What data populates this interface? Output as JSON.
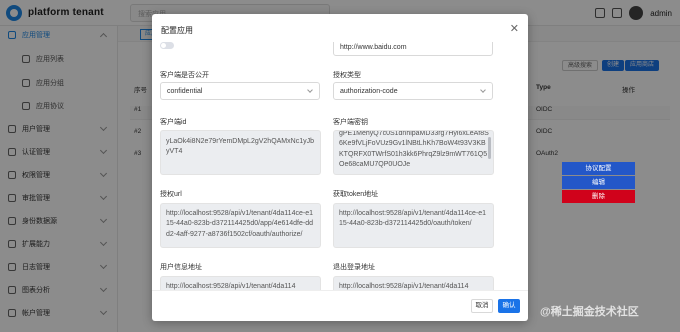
{
  "header": {
    "brand": "platform tenant",
    "search_placeholder": "搜索应用",
    "user": "admin"
  },
  "sidebar": {
    "items": [
      {
        "label": "应用管理",
        "icon": "grid-icon"
      },
      {
        "label": "应用列表",
        "icon": "list-icon"
      },
      {
        "label": "应用分组",
        "icon": "list-icon"
      },
      {
        "label": "应用协议",
        "icon": "doc-icon"
      },
      {
        "label": "用户管理",
        "icon": "user-icon"
      },
      {
        "label": "认证管理",
        "icon": "shield-icon"
      },
      {
        "label": "权限管理",
        "icon": "key-icon"
      },
      {
        "label": "审批管理",
        "icon": "check-icon"
      },
      {
        "label": "身份数据源",
        "icon": "database-icon"
      },
      {
        "label": "扩展能力",
        "icon": "puzzle-icon"
      },
      {
        "label": "日志管理",
        "icon": "log-icon"
      },
      {
        "label": "图表分析",
        "icon": "chart-icon"
      },
      {
        "label": "帐户管理",
        "icon": "account-icon"
      }
    ]
  },
  "content": {
    "tab_label": "应用",
    "buttons": {
      "search": "高级搜索",
      "create": "创建",
      "store": "应用商店"
    },
    "table": {
      "headers": {
        "index": "序号",
        "type": "Type",
        "actions": "操作"
      },
      "rows": [
        {
          "index": "#1",
          "type": "OIDC"
        },
        {
          "index": "#2",
          "type": "OIDC"
        },
        {
          "index": "#3",
          "type": "OAuth2"
        }
      ]
    },
    "row_menu": [
      "协议配置",
      "编辑",
      "删除"
    ]
  },
  "modal": {
    "title": "配置应用",
    "fields": {
      "homepage_value": "http://www.baidu.com",
      "is_public_label": "客户端是否公开",
      "is_public_value": "confidential",
      "grant_type_label": "授权类型",
      "grant_type_value": "authorization-code",
      "client_id_label": "客户端id",
      "client_id_value": "yLaOk4i8N2e79rYemDMpL2gV2hQAMxNc1yJbyVT4",
      "client_secret_label": "客户端密钥",
      "client_secret_value": "gPE1MehyQ7c0S1dnhipaMD33rg7Hyl6xLeAf8S6Ke9fVLjFoVUz9Gv1lNBtLhKh7BoW4t93V3KBKTQRFX0TWrfS01h3kk6PhrqZ9lz9mWT761Q5Oe68caMU7QP0UOJe",
      "auth_url_label": "授权url",
      "auth_url_value": "http://localhost:9528/api/v1/tenant/4da114ce-e115-44a0-823b-d372114425d0/app/4e614dfe-ddd2-4aff-9277-a8736f1502cf/oauth/authorize/",
      "token_url_label": "获取token地址",
      "token_url_value": "http://localhost:9528/api/v1/tenant/4da114ce-e115-44a0-823b-d372114425d0/oauth/token/",
      "userinfo_label": "用户信息地址",
      "userinfo_value": "http://localhost:9528/api/v1/tenant/4da114",
      "logout_label": "退出登录地址",
      "logout_value": "http://localhost:9528/api/v1/tenant/4da114"
    },
    "footer": {
      "cancel": "取消",
      "ok": "确认"
    }
  },
  "watermark": "@稀土掘金技术社区",
  "colors": {
    "primary": "#1a73e8",
    "danger": "#d0021b",
    "menu_blue": "#2357c8"
  }
}
